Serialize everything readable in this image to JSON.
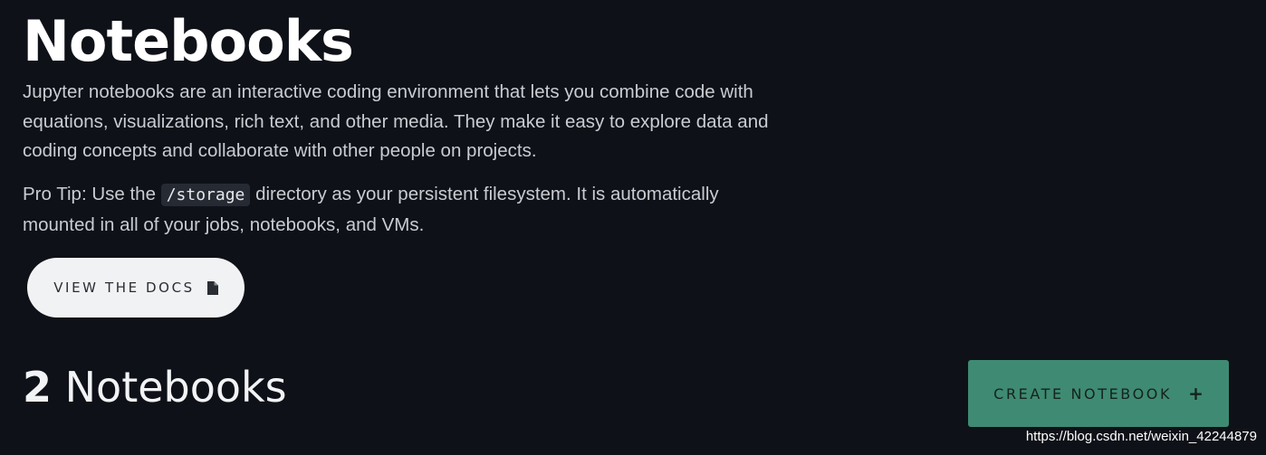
{
  "header": {
    "title": "Notebooks",
    "intro": "Jupyter notebooks are an interactive coding environment that lets you combine code with equations, visualizations, rich text, and other media. They make it easy to explore data and coding concepts and collaborate with other people on projects."
  },
  "tip": {
    "prefix": "Pro Tip: Use the ",
    "code": "/storage",
    "suffix": " directory as your persistent filesystem. It is automatically mounted in all of your jobs, notebooks, and VMs."
  },
  "docs_button": {
    "label": "VIEW THE DOCS",
    "icon": "file-icon"
  },
  "notebooks": {
    "count": "2",
    "label": " Notebooks"
  },
  "create_button": {
    "label": "CREATE NOTEBOOK",
    "icon": "+"
  },
  "watermark": "https://blog.csdn.net/weixin_42244879",
  "colors": {
    "background": "#0e1118",
    "accent": "#3f8a72",
    "docs_button_bg": "#f1f2f4"
  }
}
